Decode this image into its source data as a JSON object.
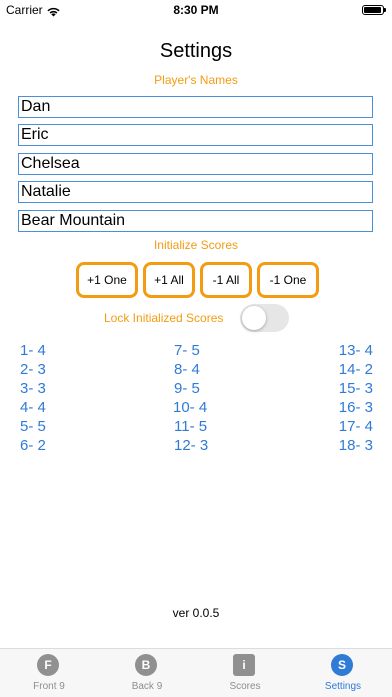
{
  "status_bar": {
    "carrier": "Carrier",
    "time": "8:30 PM",
    "battery_level": 0.95
  },
  "title": "Settings",
  "players": {
    "label": "Player's Names",
    "names": [
      "Dan",
      "Eric",
      "Chelsea",
      "Natalie",
      "Bear Mountain"
    ]
  },
  "initialize": {
    "label": "Initialize Scores",
    "buttons": [
      "+1 One",
      "+1 All",
      "-1 All",
      "-1 One"
    ]
  },
  "lock": {
    "label": "Lock Initialized Scores",
    "enabled": false
  },
  "holes": [
    "1- 4",
    "2- 3",
    "3- 3",
    "4- 4",
    "5- 5",
    "6- 2",
    "7- 5",
    "8- 4",
    "9- 5",
    "10- 4",
    "11- 5",
    "12- 3",
    "13- 4",
    "14- 2",
    "15- 3",
    "16- 3",
    "17- 4",
    "18- 3"
  ],
  "version": "ver 0.0.5",
  "tabs": [
    {
      "icon": "F",
      "label": "Front 9",
      "active": false
    },
    {
      "icon": "B",
      "label": "Back 9",
      "active": false
    },
    {
      "icon": "i",
      "label": "Scores",
      "active": false
    },
    {
      "icon": "S",
      "label": "Settings",
      "active": true
    }
  ],
  "colors": {
    "accent": "#f39c12",
    "link": "#2f7bd6",
    "field_border": "#4a90d9"
  }
}
